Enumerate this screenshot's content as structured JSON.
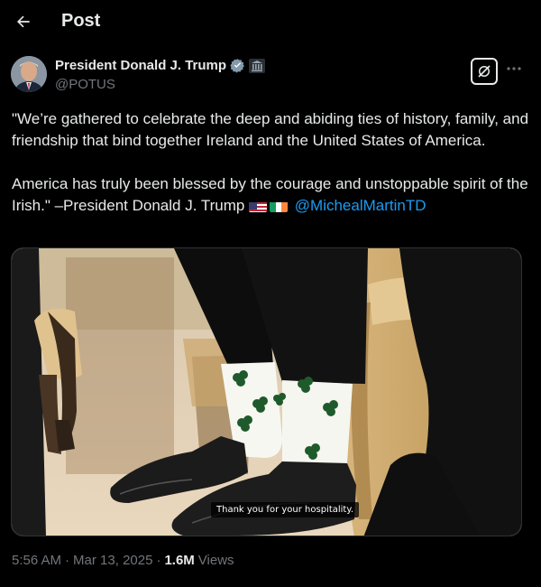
{
  "topbar": {
    "title": "Post"
  },
  "author": {
    "display_name": "President Donald J. Trump",
    "handle": "@POTUS"
  },
  "tweet": {
    "paragraph1": "\"We’re gathered to celebrate the deep and abiding ties of history, family, and friendship that bind together Ireland and the United States of America.",
    "paragraph2_text": "America has truly been blessed by the courage and unstoppable spirit of the Irish.\" –President Donald J. Trump ",
    "mention": "@MichealMartinTD"
  },
  "media": {
    "caption": "Thank you for your hospitality."
  },
  "meta": {
    "time": "5:56 AM",
    "separator": "·",
    "date": "Mar 13, 2025",
    "views_count": "1.6M",
    "views_label": "Views"
  },
  "colors": {
    "accent": "#1d9bf0",
    "verified": "#829aab",
    "background": "#000000",
    "muted": "#71767b"
  },
  "icons": [
    "back-arrow-icon",
    "verified-badge-icon",
    "government-building-icon",
    "grok-icon",
    "more-icon",
    "us-flag-icon",
    "ireland-flag-icon"
  ]
}
